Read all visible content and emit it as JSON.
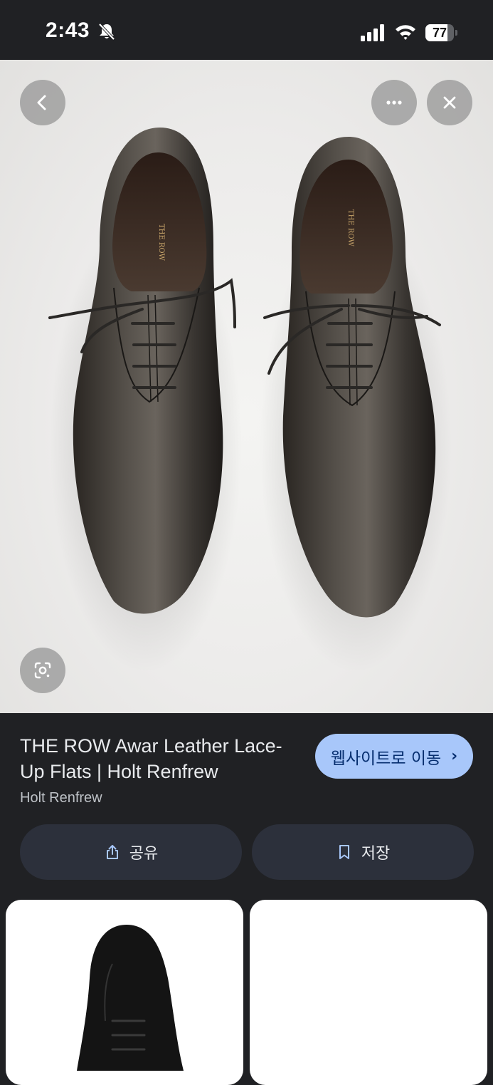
{
  "status_bar": {
    "time": "2:43",
    "battery_percent": 77,
    "battery_label": "77",
    "icons": [
      "bell-slash-icon",
      "cellular-signal-icon",
      "wifi-icon",
      "battery-icon"
    ]
  },
  "image_viewer": {
    "icons": {
      "back": "chevron-left-icon",
      "more": "more-horizontal-icon",
      "close": "close-icon",
      "lens": "google-lens-icon"
    },
    "insole_label": "THE ROW"
  },
  "product": {
    "title": "THE ROW Awar Leather Lace-Up Flats | Holt Renfrew",
    "source": "Holt Renfrew",
    "visit_label": "웹사이트로 이동",
    "visit_chevron": "›"
  },
  "actions": {
    "share_label": "공유",
    "share_icon": "share-icon",
    "save_label": "저장",
    "save_icon": "bookmark-icon"
  },
  "colors": {
    "background": "#202124",
    "accent_button": "#a8c7fa",
    "action_button": "#2c303b"
  }
}
